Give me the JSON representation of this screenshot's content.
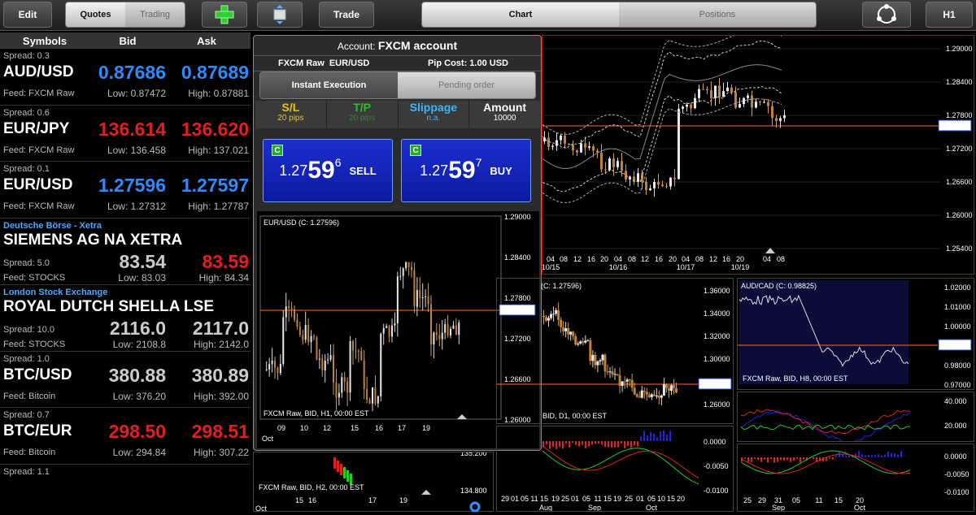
{
  "toolbar": {
    "edit": "Edit",
    "quotes": "Quotes",
    "trading": "Trading",
    "add_icon": "plus-icon",
    "layout_icon": "layout-icon",
    "trade": "Trade",
    "chart": "Chart",
    "positions": "Positions",
    "sync_icon": "sync-icon",
    "timeframe": "H1"
  },
  "watchlist": {
    "headers": [
      "Symbols",
      "Bid",
      "Ask"
    ],
    "rows": [
      {
        "spread": "Spread: 0.3",
        "symbol": "AUD/USD",
        "bid": "0.87686",
        "ask": "0.87689",
        "feed": "Feed: FXCM Raw",
        "low": "Low: 0.87472",
        "high": "High: 0.87881",
        "bid_color": "blue",
        "ask_color": "blue"
      },
      {
        "spread": "Spread: 0.6",
        "symbol": "EUR/JPY",
        "bid": "136.614",
        "ask": "136.620",
        "feed": "Feed: FXCM Raw",
        "low": "Low: 136.458",
        "high": "High: 137.021",
        "bid_color": "red",
        "ask_color": "red"
      },
      {
        "spread": "Spread: 0.1",
        "symbol": "EUR/USD",
        "bid": "1.27596",
        "ask": "1.27597",
        "feed": "Feed: FXCM Raw",
        "low": "Low: 1.27312",
        "high": "High: 1.27787",
        "bid_color": "blue",
        "ask_color": "blue"
      },
      {
        "exchange": "Deutsche Börse - Xetra",
        "symbol": "SIEMENS AG NA XETRA",
        "spread": "Spread: 5.0",
        "bid": "83.54",
        "ask": "83.59",
        "feed": "Feed: STOCKS",
        "low": "Low: 83.03",
        "high": "High: 84.34",
        "bid_color": "grey",
        "ask_color": "red"
      },
      {
        "exchange": "London Stock Exchange",
        "symbol": "ROYAL DUTCH SHELLA LSE",
        "spread": "Spread: 10.0",
        "bid": "2116.0",
        "ask": "2117.0",
        "feed": "Feed: STOCKS",
        "low": "Low: 2108.8",
        "high": "High: 2142.0",
        "bid_color": "grey",
        "ask_color": "grey"
      },
      {
        "spread": "Spread: 1.0",
        "symbol": "BTC/USD",
        "bid": "380.88",
        "ask": "380.89",
        "feed": "Feed: Bitcoin",
        "low": "Low: 376.20",
        "high": "High: 392.00",
        "bid_color": "grey",
        "ask_color": "grey"
      },
      {
        "spread": "Spread: 0.7",
        "symbol": "BTC/EUR",
        "bid": "298.50",
        "ask": "298.51",
        "feed": "Feed: Bitcoin",
        "low": "Low: 294.84",
        "high": "High: 307.22",
        "bid_color": "red",
        "ask_color": "red"
      },
      {
        "spread": "Spread: 1.1"
      }
    ]
  },
  "dialog": {
    "account_label": "Account:",
    "account": "FXCM account",
    "feed": "FXCM Raw",
    "pair": "EUR/USD",
    "pip_cost": "Pip Cost: 1.00 USD",
    "tab_instant": "Instant Execution",
    "tab_pending": "Pending order",
    "sl_label": "S/L",
    "sl_value": "20 pips",
    "tp_label": "T/P",
    "tp_value": "20 pips",
    "slippage_label": "Slippage",
    "slippage_value": "n.a.",
    "amount_label": "Amount",
    "amount_value": "10000",
    "sell": {
      "badge": "C",
      "prefix": "1.27",
      "main": "59",
      "pip": "6",
      "action": "SELL"
    },
    "buy": {
      "badge": "C",
      "prefix": "1.27",
      "main": "59",
      "pip": "7",
      "action": "BUY"
    },
    "mini_chart": {
      "title": "EUR/USD (C: 1.27596)",
      "footer": "FXCM Raw, BID, H1, 00:00 EST",
      "y_ticks": [
        "1.29000",
        "1.28400",
        "1.27800",
        "1.27200",
        "1.26600",
        "1.26000"
      ],
      "x_ticks": [
        "09",
        "10",
        "12",
        "15",
        "16",
        "17",
        "19"
      ],
      "month": "Oct",
      "current": "1.27596"
    }
  },
  "charts": {
    "main": {
      "y_ticks": [
        "1.29000",
        "1.28400",
        "1.27800",
        "1.27200",
        "1.26600",
        "1.26000",
        "1.25400"
      ],
      "x_ticks": [
        "04",
        "08",
        "12",
        "16",
        "20",
        "04",
        "08",
        "12",
        "16",
        "20",
        "04",
        "08",
        "12",
        "16",
        "20",
        "04",
        "08"
      ],
      "dates": [
        "10/15",
        "10/16",
        "10/17",
        "10/19"
      ],
      "current": "1.27596"
    },
    "mid": {
      "title": "(C: 1.27596)",
      "y_ticks": [
        "1.36000",
        "1.34000",
        "1.32000",
        "1.30000",
        "1.28000",
        "1.26000"
      ],
      "footer": "BID, D1, 00:00 EST",
      "current": "1.27596",
      "osc_ticks": [
        "0.0000",
        "-0.0050",
        "-0.0100"
      ],
      "x_ticks": [
        "29",
        "01",
        "05",
        "11",
        "15",
        "19",
        "25",
        "01",
        "05",
        "11",
        "15",
        "19",
        "25",
        "01",
        "05",
        "10",
        "15",
        "20"
      ],
      "months": [
        "Aug",
        "Sep",
        "Oct"
      ]
    },
    "audcad": {
      "title": "AUD/CAD (C: 0.98825)",
      "y_ticks": [
        "1.02000",
        "1.01000",
        "1.00000",
        "0.99000",
        "0.98000",
        "0.97000"
      ],
      "footer": "FXCM Raw, BID, H8, 00:00 EST",
      "current": "0.98825",
      "ind_ticks": [
        "40.000",
        "20.000"
      ],
      "osc_ticks": [
        "0.0000",
        "-0.0050",
        "-0.0100"
      ],
      "x_ticks": [
        "25",
        "29",
        "31",
        "05",
        "11",
        "15",
        "20"
      ],
      "months": [
        "Sep",
        "Oct"
      ]
    },
    "bottomleft": {
      "footer": "FXCM Raw, BID, H2, 00:00 EST",
      "y_ticks": [
        "135.200",
        "134.800"
      ],
      "x_ticks": [
        "15",
        "16",
        "17",
        "19"
      ],
      "month": "Oct"
    }
  }
}
